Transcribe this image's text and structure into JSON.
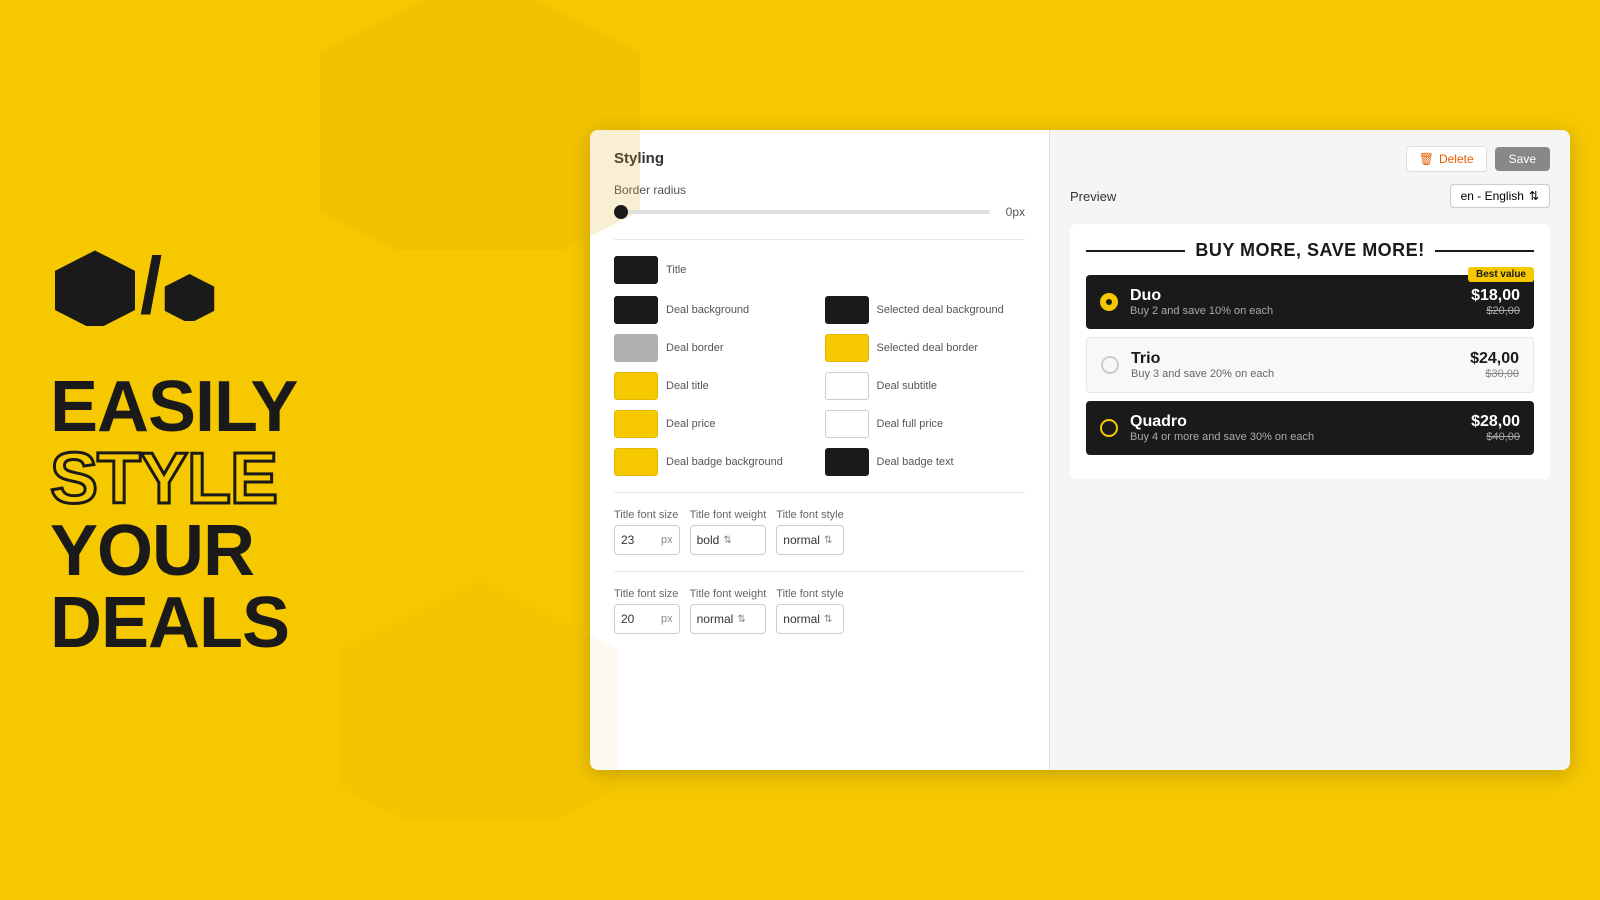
{
  "left": {
    "tagline": {
      "easily": "EASILY",
      "style": "STYLE",
      "your": "YOUR",
      "deals": "DEALS"
    }
  },
  "toolbar": {
    "delete_label": "Delete",
    "save_label": "Save"
  },
  "styling_panel": {
    "title": "Styling",
    "border_radius_label": "Border radius",
    "border_radius_value": "0px",
    "colors": {
      "title_label": "Title",
      "deal_bg_label": "Deal background",
      "selected_deal_bg_label": "Selected deal background",
      "deal_border_label": "Deal border",
      "selected_deal_border_label": "Selected deal border",
      "deal_title_label": "Deal title",
      "deal_subtitle_label": "Deal subtitle",
      "deal_price_label": "Deal price",
      "deal_full_price_label": "Deal full price",
      "deal_badge_bg_label": "Deal badge background",
      "deal_badge_text_label": "Deal badge text"
    },
    "font_row1": {
      "size_label": "Title font size",
      "weight_label": "Title font weight",
      "style_label": "Title font style",
      "size_value": "23",
      "size_unit": "px",
      "weight_value": "bold",
      "style_value": "normal"
    },
    "font_row2": {
      "size_label": "Title font size",
      "weight_label": "Title font weight",
      "style_label": "Title font style",
      "size_value": "20",
      "size_unit": "px",
      "weight_value": "normal",
      "style_value": "normal"
    }
  },
  "preview": {
    "label": "Preview",
    "language": "en - English",
    "promo_title": "BUY MORE, SAVE MORE!",
    "deals": [
      {
        "name": "Duo",
        "subtitle": "Buy 2 and save 10% on each",
        "price": "$18,00",
        "original_price": "$20,00",
        "badge": "Best value",
        "selected": true,
        "dark": true
      },
      {
        "name": "Trio",
        "subtitle": "Buy 3 and save 20% on each",
        "price": "$24,00",
        "original_price": "$30,00",
        "badge": "",
        "selected": false,
        "dark": false
      },
      {
        "name": "Quadro",
        "subtitle": "Buy 4 or more and save 30% on each",
        "price": "$28,00",
        "original_price": "$40,00",
        "badge": "",
        "selected": false,
        "dark": true
      }
    ]
  }
}
